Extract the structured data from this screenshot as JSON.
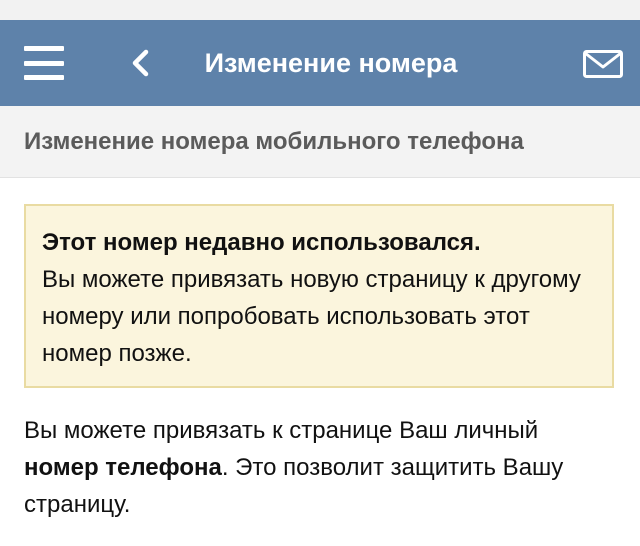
{
  "navbar": {
    "title": "Изменение номера",
    "icons": {
      "menu": "menu-icon",
      "back": "chevron-left-icon",
      "mail": "mail-icon"
    }
  },
  "section_header": {
    "title": "Изменение номера мобильного телефона"
  },
  "notice": {
    "title": "Этот номер недавно использовался.",
    "text": "Вы можете привязать новую страницу к другому номеру или попробовать использовать этот номер позже."
  },
  "info": {
    "text_before": "Вы можете привязать к странице Ваш личный ",
    "text_bold": "номер телефона",
    "text_after": ". Это позволит защитить Вашу страницу."
  },
  "colors": {
    "navbar_bg": "#5e82aa",
    "notice_bg": "#fbf5dd",
    "notice_border": "#e9dba2"
  }
}
